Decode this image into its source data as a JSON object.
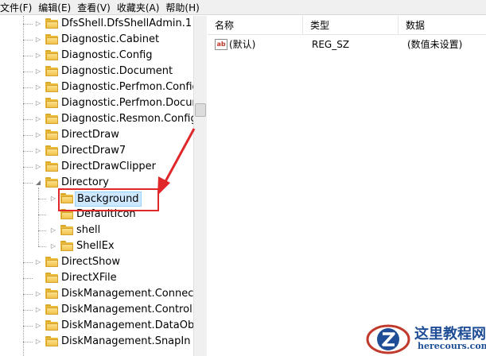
{
  "menubar": {
    "items": [
      "文件(F)",
      "编辑(E)",
      "查看(V)",
      "收藏夹(A)",
      "帮助(H)"
    ]
  },
  "tree": {
    "items": [
      {
        "label": "DfsShell.DfsShellAdmin.1",
        "depth": 0,
        "expander": "collapsed"
      },
      {
        "label": "Diagnostic.Cabinet",
        "depth": 0,
        "expander": "collapsed"
      },
      {
        "label": "Diagnostic.Config",
        "depth": 0,
        "expander": "collapsed"
      },
      {
        "label": "Diagnostic.Document",
        "depth": 0,
        "expander": "collapsed"
      },
      {
        "label": "Diagnostic.Perfmon.Config",
        "depth": 0,
        "expander": "collapsed"
      },
      {
        "label": "Diagnostic.Perfmon.Docume",
        "depth": 0,
        "expander": "collapsed"
      },
      {
        "label": "Diagnostic.Resmon.Config",
        "depth": 0,
        "expander": "collapsed"
      },
      {
        "label": "DirectDraw",
        "depth": 0,
        "expander": "collapsed"
      },
      {
        "label": "DirectDraw7",
        "depth": 0,
        "expander": "collapsed"
      },
      {
        "label": "DirectDrawClipper",
        "depth": 0,
        "expander": "collapsed"
      },
      {
        "label": "Directory",
        "depth": 0,
        "expander": "expanded"
      },
      {
        "label": "Background",
        "depth": 1,
        "expander": "collapsed",
        "selected": true
      },
      {
        "label": "DefaultIcon",
        "depth": 1,
        "expander": "none"
      },
      {
        "label": "shell",
        "depth": 1,
        "expander": "collapsed"
      },
      {
        "label": "ShellEx",
        "depth": 1,
        "expander": "collapsed"
      },
      {
        "label": "DirectShow",
        "depth": 0,
        "expander": "collapsed"
      },
      {
        "label": "DirectXFile",
        "depth": 0,
        "expander": "none"
      },
      {
        "label": "DiskManagement.Connectio",
        "depth": 0,
        "expander": "collapsed"
      },
      {
        "label": "DiskManagement.Control",
        "depth": 0,
        "expander": "collapsed"
      },
      {
        "label": "DiskManagement.DataObjec",
        "depth": 0,
        "expander": "collapsed"
      },
      {
        "label": "DiskManagement.SnapIn",
        "depth": 0,
        "expander": "collapsed"
      }
    ]
  },
  "list": {
    "headers": {
      "name": "名称",
      "type": "类型",
      "data": "数据"
    },
    "rows": [
      {
        "icon": "ab",
        "name": "(默认)",
        "type": "REG_SZ",
        "data": "(数值未设置)"
      }
    ]
  },
  "annotation": {
    "color": "#e0282a"
  },
  "watermark": {
    "title": "这里教程网",
    "subtitle": "herecours.com",
    "color": "#1f4e96"
  }
}
